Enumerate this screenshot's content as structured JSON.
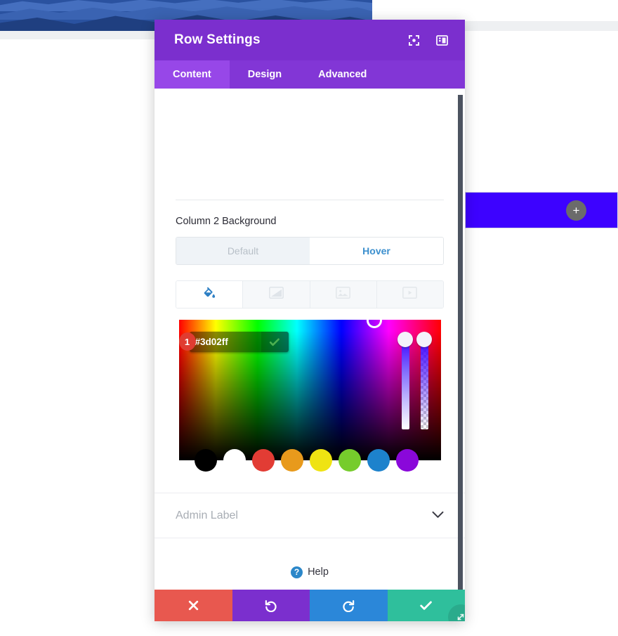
{
  "accent_color": "#3d02ff",
  "backdrop": {
    "hero_banner_name": "blue-wave-hero-banner",
    "row_bar_color": "#3d02ff",
    "add_row_label": "+"
  },
  "modal": {
    "title": "Row Settings",
    "header_icons": [
      {
        "name": "fullscreen-preview-icon",
        "title": "Preview"
      },
      {
        "name": "layout-panel-icon",
        "title": "Layout"
      }
    ],
    "tabs": [
      {
        "label": "Content",
        "active": true
      },
      {
        "label": "Design",
        "active": false
      },
      {
        "label": "Advanced",
        "active": false
      }
    ]
  },
  "background_section": {
    "label": "Column 2 Background",
    "state_toggle": [
      {
        "label": "Default",
        "active": false
      },
      {
        "label": "Hover",
        "active": true
      }
    ],
    "type_tabs": [
      {
        "name": "background-color-icon",
        "label": "Background Color",
        "active": true
      },
      {
        "name": "background-gradient-icon",
        "label": "Background Gradient",
        "active": false
      },
      {
        "name": "background-image-icon",
        "label": "Background Image",
        "active": false
      },
      {
        "name": "background-video-icon",
        "label": "Background Video",
        "active": false
      }
    ]
  },
  "color_picker": {
    "hex_value": "#3d02ff",
    "hex_placeholder": "#ffffff",
    "confirm_icon": "checkmark-icon",
    "step_badge": "1",
    "swatches": [
      {
        "name": "swatch-black",
        "color": "#000000"
      },
      {
        "name": "swatch-white",
        "color": "#ffffff"
      },
      {
        "name": "swatch-red",
        "color": "#e23c34"
      },
      {
        "name": "swatch-orange",
        "color": "#e89a1c"
      },
      {
        "name": "swatch-yellow",
        "color": "#efe312"
      },
      {
        "name": "swatch-green",
        "color": "#76cc2c"
      },
      {
        "name": "swatch-blue",
        "color": "#1d82cc"
      },
      {
        "name": "swatch-purple",
        "color": "#8a08da"
      }
    ]
  },
  "admin_label": {
    "label": "Admin Label",
    "chevron": "⌄"
  },
  "help": {
    "label": "Help",
    "icon_glyph": "?"
  },
  "footer": {
    "buttons": [
      {
        "name": "cancel-button",
        "glyph": "✖",
        "color": "#e8584f"
      },
      {
        "name": "undo-button",
        "glyph": "↺",
        "color": "#7b2fce"
      },
      {
        "name": "redo-button",
        "glyph": "↻",
        "color": "#2b87d9"
      },
      {
        "name": "save-button",
        "glyph": "✔",
        "color": "#2fbf9c"
      }
    ],
    "resize_handle": "resize-handle-icon"
  }
}
